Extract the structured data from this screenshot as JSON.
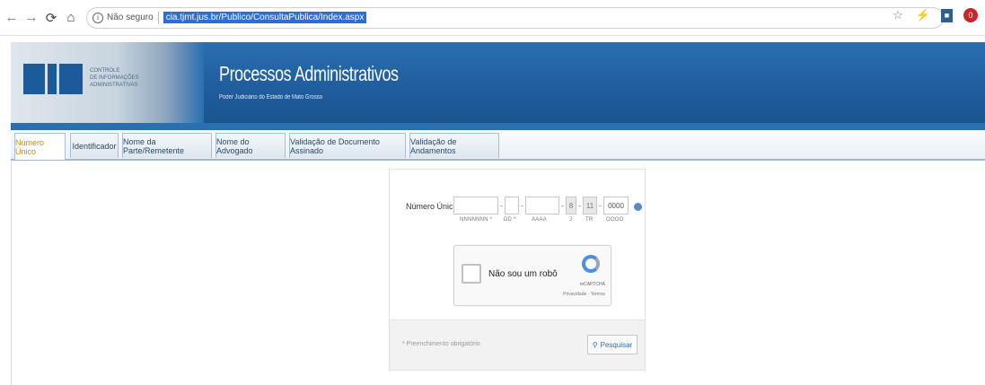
{
  "browser": {
    "security": "Não seguro",
    "url": "cia.tjmt.jus.br/Publico/ConsultaPublica/Index.aspx"
  },
  "header": {
    "logo_text": "CIA",
    "org_lines": [
      "CONTROLE",
      "DE INFORMAÇÕES",
      "ADMINISTRATIVAS"
    ],
    "title": "Processos Administrativos",
    "subtitle": "Poder Judiciário do Estado de Mato Grosso"
  },
  "tabs": [
    {
      "label": "Número Único",
      "active": true
    },
    {
      "label": "Identificador",
      "active": false
    },
    {
      "label": "Nome da Parte/Remetente",
      "active": false
    },
    {
      "label": "Nome do Advogado",
      "active": false
    },
    {
      "label": "Validação de Documento Assinado",
      "active": false
    },
    {
      "label": "Validação de Andamentos",
      "active": false
    }
  ],
  "form": {
    "label": "Número Único:",
    "fields": [
      {
        "value": "",
        "hint": "NNNNNNN *"
      },
      {
        "value": "",
        "hint": "DD *"
      },
      {
        "value": "",
        "hint": "AAAA"
      },
      {
        "value": "8",
        "hint": "J"
      },
      {
        "value": "11",
        "hint": "TR"
      },
      {
        "value": "0000",
        "hint": "OOOO"
      }
    ],
    "captcha": {
      "label": "Não sou um robô",
      "brand": "reCAPTCHA",
      "privacy": "Privacidade - Termos"
    },
    "required_note": "* Preenchimento obrigatório",
    "search_label": "Pesquisar"
  }
}
